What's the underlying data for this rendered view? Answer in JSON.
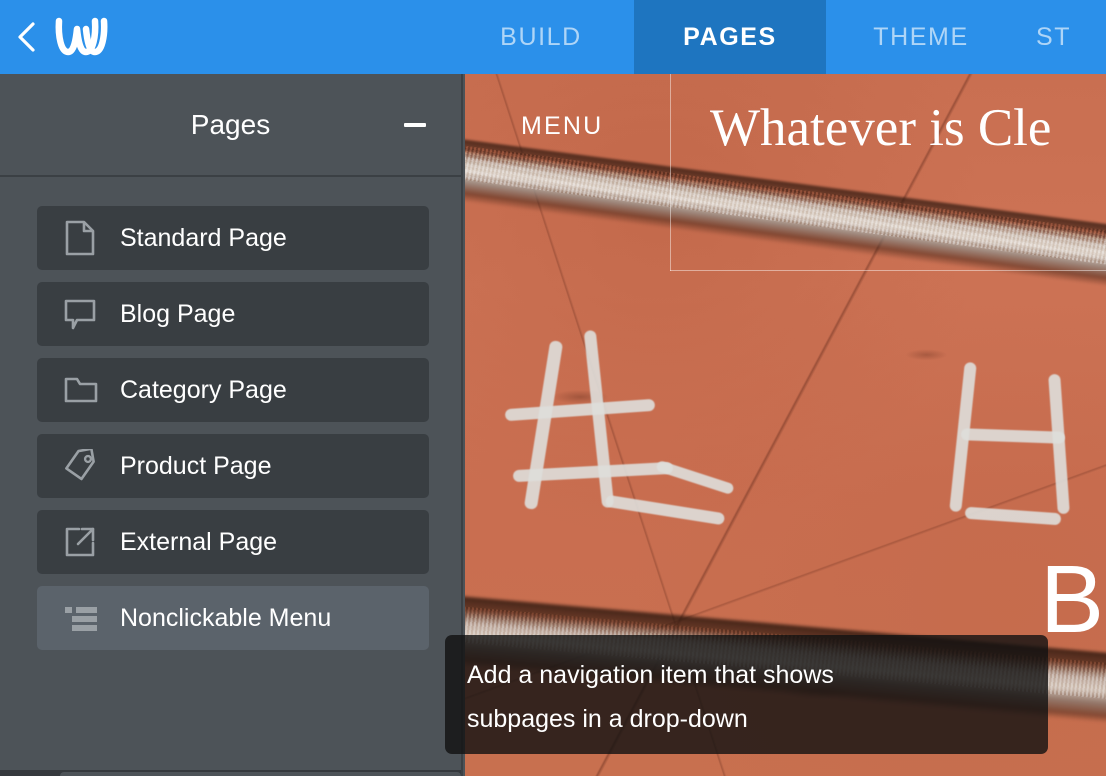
{
  "header": {
    "back_icon": "chevron-left-icon",
    "logo": "weebly-logo",
    "tabs": [
      {
        "label": "BUILD",
        "active": false
      },
      {
        "label": "PAGES",
        "active": true
      },
      {
        "label": "THEME",
        "active": false
      },
      {
        "label": "ST",
        "active": false
      }
    ],
    "brand_color": "#2b90ea",
    "active_tab_color": "#1e75c0"
  },
  "sidebar": {
    "title": "Pages",
    "collapse_icon": "minus-icon",
    "background_color": "#4d5358",
    "item_color": "#393e42",
    "item_hover_color": "#5b636b",
    "items": [
      {
        "label": "Standard Page",
        "icon": "document-icon",
        "hovered": false
      },
      {
        "label": "Blog Page",
        "icon": "speech-bubble-icon",
        "hovered": false
      },
      {
        "label": "Category Page",
        "icon": "folder-icon",
        "hovered": false
      },
      {
        "label": "Product Page",
        "icon": "tag-icon",
        "hovered": false
      },
      {
        "label": "External Page",
        "icon": "external-link-icon",
        "hovered": false
      },
      {
        "label": "Nonclickable Menu",
        "icon": "list-indent-icon",
        "hovered": true
      }
    ]
  },
  "tooltip": {
    "text": "Add a navigation item that shows\nsubpages in a drop-down"
  },
  "preview": {
    "menu_label": "MENU",
    "site_heading": "Whatever is Cle",
    "corner_letter": "B"
  }
}
